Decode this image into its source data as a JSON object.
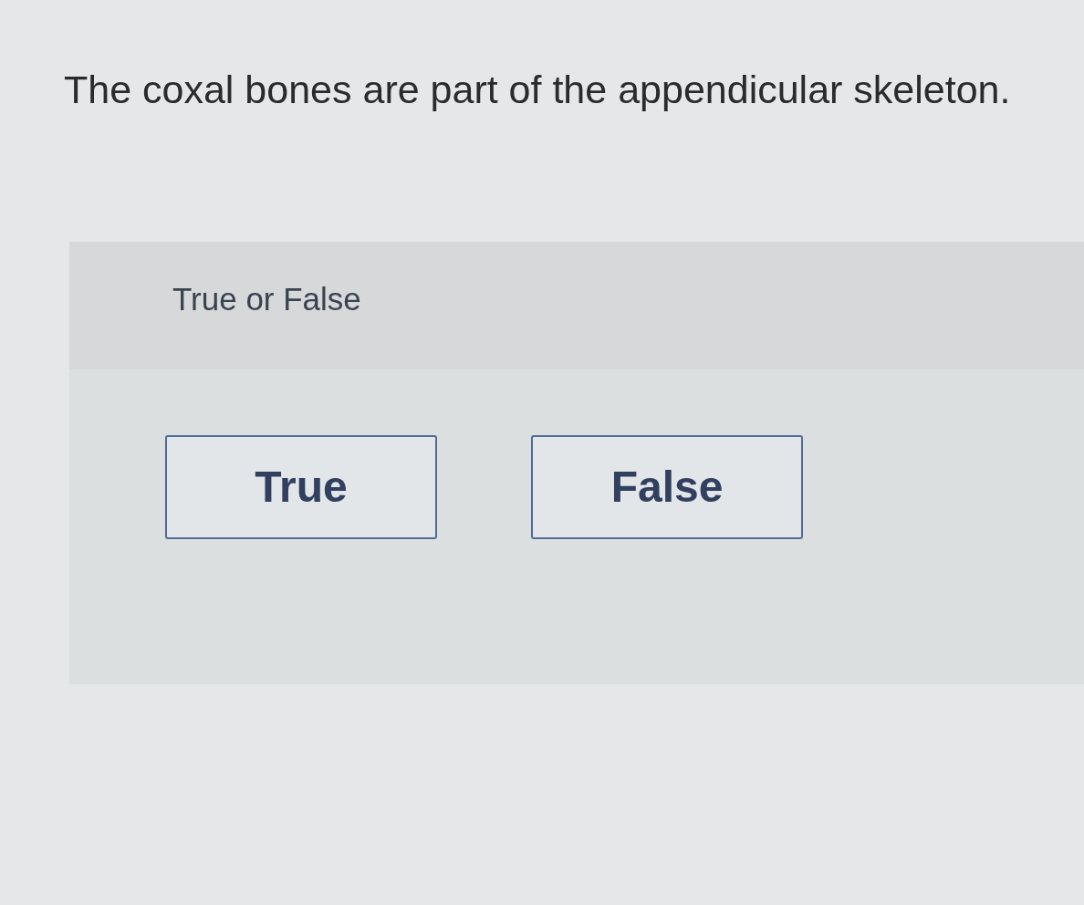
{
  "question": {
    "text": "The coxal bones are part of the appendicular skeleton."
  },
  "answer_panel": {
    "prompt": "True or False",
    "options": [
      {
        "label": "True",
        "selected": false
      },
      {
        "label": "False",
        "selected": false
      }
    ]
  }
}
